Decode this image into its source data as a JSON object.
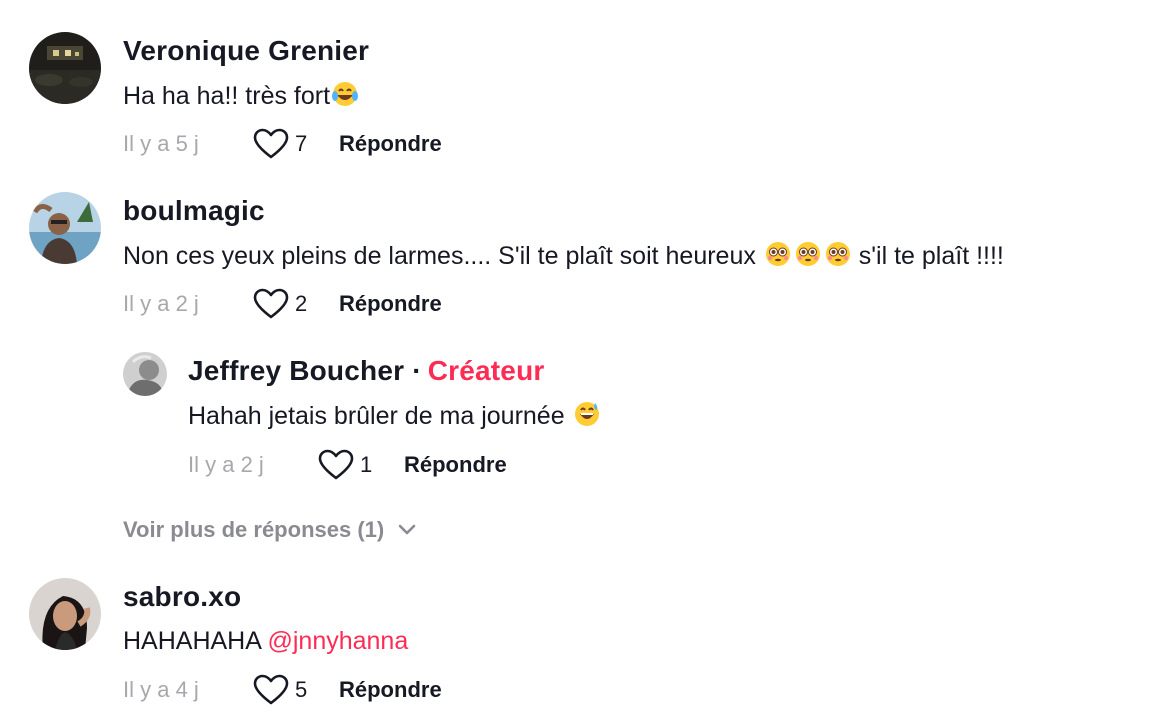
{
  "comments": [
    {
      "username": "Veronique Grenier",
      "text": "Ha ha ha!! très fort",
      "emoji": "tears-of-joy-emoji",
      "time": "Il y a 5 j",
      "likes": "7",
      "reply_label": "Répondre"
    },
    {
      "username": "boulmagic",
      "text": "Non ces yeux pleins de larmes.... S'il te plaît soit heureux ",
      "emoji": "flushed-face-emoji",
      "text_after": " s'il te plaît !!!!",
      "time": "Il y a 2 j",
      "likes": "2",
      "reply_label": "Répondre",
      "replies": [
        {
          "username": "Jeffrey Boucher",
          "creator_label": "Créateur",
          "text": "Hahah jetais brûler de ma journée ",
          "emoji": "grinning-sweat-emoji",
          "time": "Il y a 2 j",
          "likes": "1",
          "reply_label": "Répondre"
        }
      ],
      "more_replies_label": "Voir plus de réponses (1)"
    },
    {
      "username": "sabro.xo",
      "text": "HAHAHAHA ",
      "mention": "@jnnyhanna",
      "time": "Il y a 4 j",
      "likes": "5",
      "reply_label": "Répondre"
    }
  ],
  "colors": {
    "accent": "#fe2c55",
    "text": "#161823",
    "muted": "#a7a8ad",
    "more_replies": "#8a8b91"
  },
  "icons": [
    "heart-outline-icon",
    "chevron-down-icon"
  ]
}
